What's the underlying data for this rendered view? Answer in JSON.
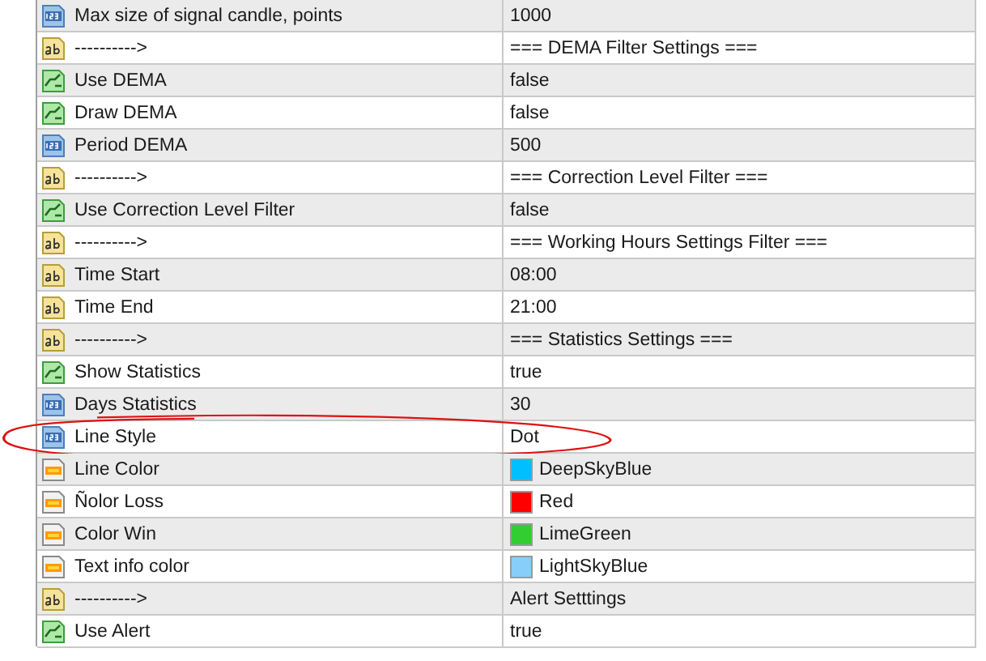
{
  "rows": [
    {
      "kind": "number",
      "name": "Max size of signal candle, points",
      "value": "1000",
      "circled": false
    },
    {
      "kind": "text",
      "name": "---------->",
      "value": "=== DEMA Filter Settings ===",
      "circled": false
    },
    {
      "kind": "bool",
      "name": "Use DEMA",
      "value": "false",
      "circled": false
    },
    {
      "kind": "bool",
      "name": "Draw DEMA",
      "value": "false",
      "circled": false
    },
    {
      "kind": "number",
      "name": "Period DEMA",
      "value": "500",
      "circled": false
    },
    {
      "kind": "text",
      "name": "---------->",
      "value": "=== Correction Level Filter ===",
      "circled": false
    },
    {
      "kind": "bool",
      "name": "Use Correction Level Filter",
      "value": "false",
      "circled": false
    },
    {
      "kind": "text",
      "name": "---------->",
      "value": "=== Working Hours Settings Filter ===",
      "circled": false
    },
    {
      "kind": "text",
      "name": "Time Start",
      "value": "08:00",
      "circled": false
    },
    {
      "kind": "text",
      "name": "Time End",
      "value": "21:00",
      "circled": false
    },
    {
      "kind": "text",
      "name": "---------->",
      "value": "=== Statistics Settings ===",
      "circled": false
    },
    {
      "kind": "bool",
      "name": "Show Statistics",
      "value": "true",
      "circled": false
    },
    {
      "kind": "number",
      "name": "Days Statistics",
      "value": "30",
      "circled": false
    },
    {
      "kind": "number",
      "name": "Line Style",
      "value": "Dot",
      "circled": true
    },
    {
      "kind": "color",
      "name": "Line Color",
      "value": "DeepSkyBlue",
      "color": "#00bfff",
      "circled": false
    },
    {
      "kind": "color",
      "name": "Ñolor Loss",
      "value": "Red",
      "color": "#ff0000",
      "circled": false
    },
    {
      "kind": "color",
      "name": "Color Win",
      "value": "LimeGreen",
      "color": "#32cd32",
      "circled": false
    },
    {
      "kind": "color",
      "name": "Text info color",
      "value": "LightSkyBlue",
      "color": "#87cefa",
      "circled": false
    },
    {
      "kind": "text",
      "name": "---------->",
      "value": "Alert Setttings",
      "circled": false
    },
    {
      "kind": "bool",
      "name": "Use Alert",
      "value": "true",
      "circled": false
    }
  ]
}
